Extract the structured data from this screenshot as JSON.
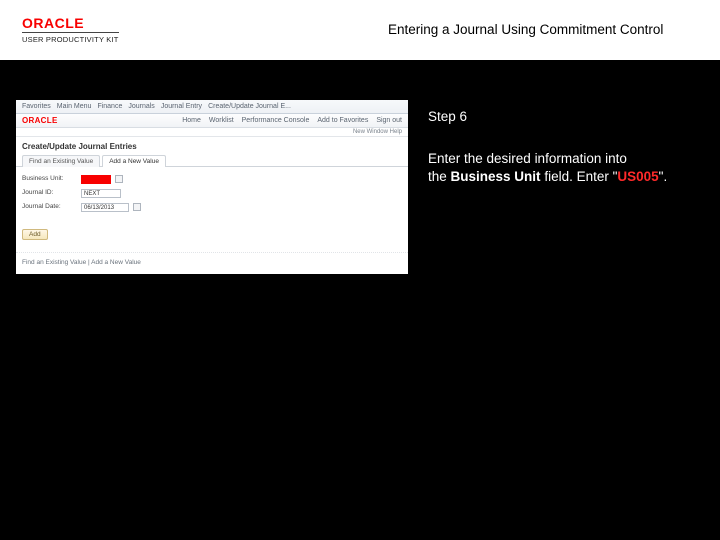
{
  "header": {
    "brand": "ORACLE",
    "sub": "USER PRODUCTIVITY KIT",
    "title": "Entering a Journal Using Commitment Control"
  },
  "instructions": {
    "step_label": "Step 6",
    "line1": "Enter the desired information into",
    "line2a": "the ",
    "field_name": "Business Unit",
    "line2b": " field. Enter \"",
    "value": "US005",
    "line2c": "\"."
  },
  "screenshot": {
    "top_nav": {
      "items": [
        "Favorites",
        "Main Menu",
        "Finance",
        "Journals",
        "Journal Entry",
        "Create/Update Journal E..."
      ]
    },
    "second_bar": {
      "brand": "ORACLE",
      "right": [
        "Home",
        "Worklist",
        "Performance Console",
        "Add to Favorites",
        "Sign out"
      ]
    },
    "strip": "New Window   Help",
    "page_heading": "Create/Update Journal Entries",
    "tabs": {
      "t1": "Find an Existing Value",
      "t2": "Add a New Value"
    },
    "form": {
      "bu_label": "Business Unit:",
      "jid_label": "Journal ID:",
      "jid_value": "NEXT",
      "jdate_label": "Journal Date:",
      "jdate_value": "06/13/2013"
    },
    "add_button": "Add",
    "footer": "Find an Existing Value | Add a New Value"
  }
}
